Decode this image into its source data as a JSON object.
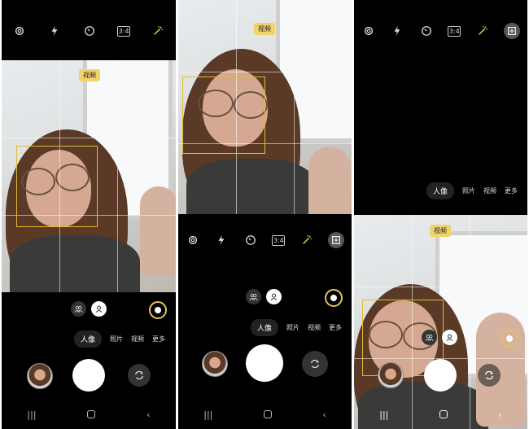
{
  "top_icons": [
    "settings-icon",
    "flash-icon",
    "timer-icon",
    "aspect-ratio-icon",
    "filter-wand-icon"
  ],
  "top_icon_extra": "gallery-preview-icon",
  "aspect_ratio_label": "3:4",
  "face_tag": "视频",
  "face_tag_p1": "视频",
  "modes": {
    "active": "人像",
    "photo": "照片",
    "video": "视频",
    "more": "更多"
  },
  "colors": {
    "focus": "#e3b930",
    "tag": "#f2d26c",
    "bg": "#000000"
  },
  "nav": {
    "recent": "|||",
    "back": "‹"
  }
}
